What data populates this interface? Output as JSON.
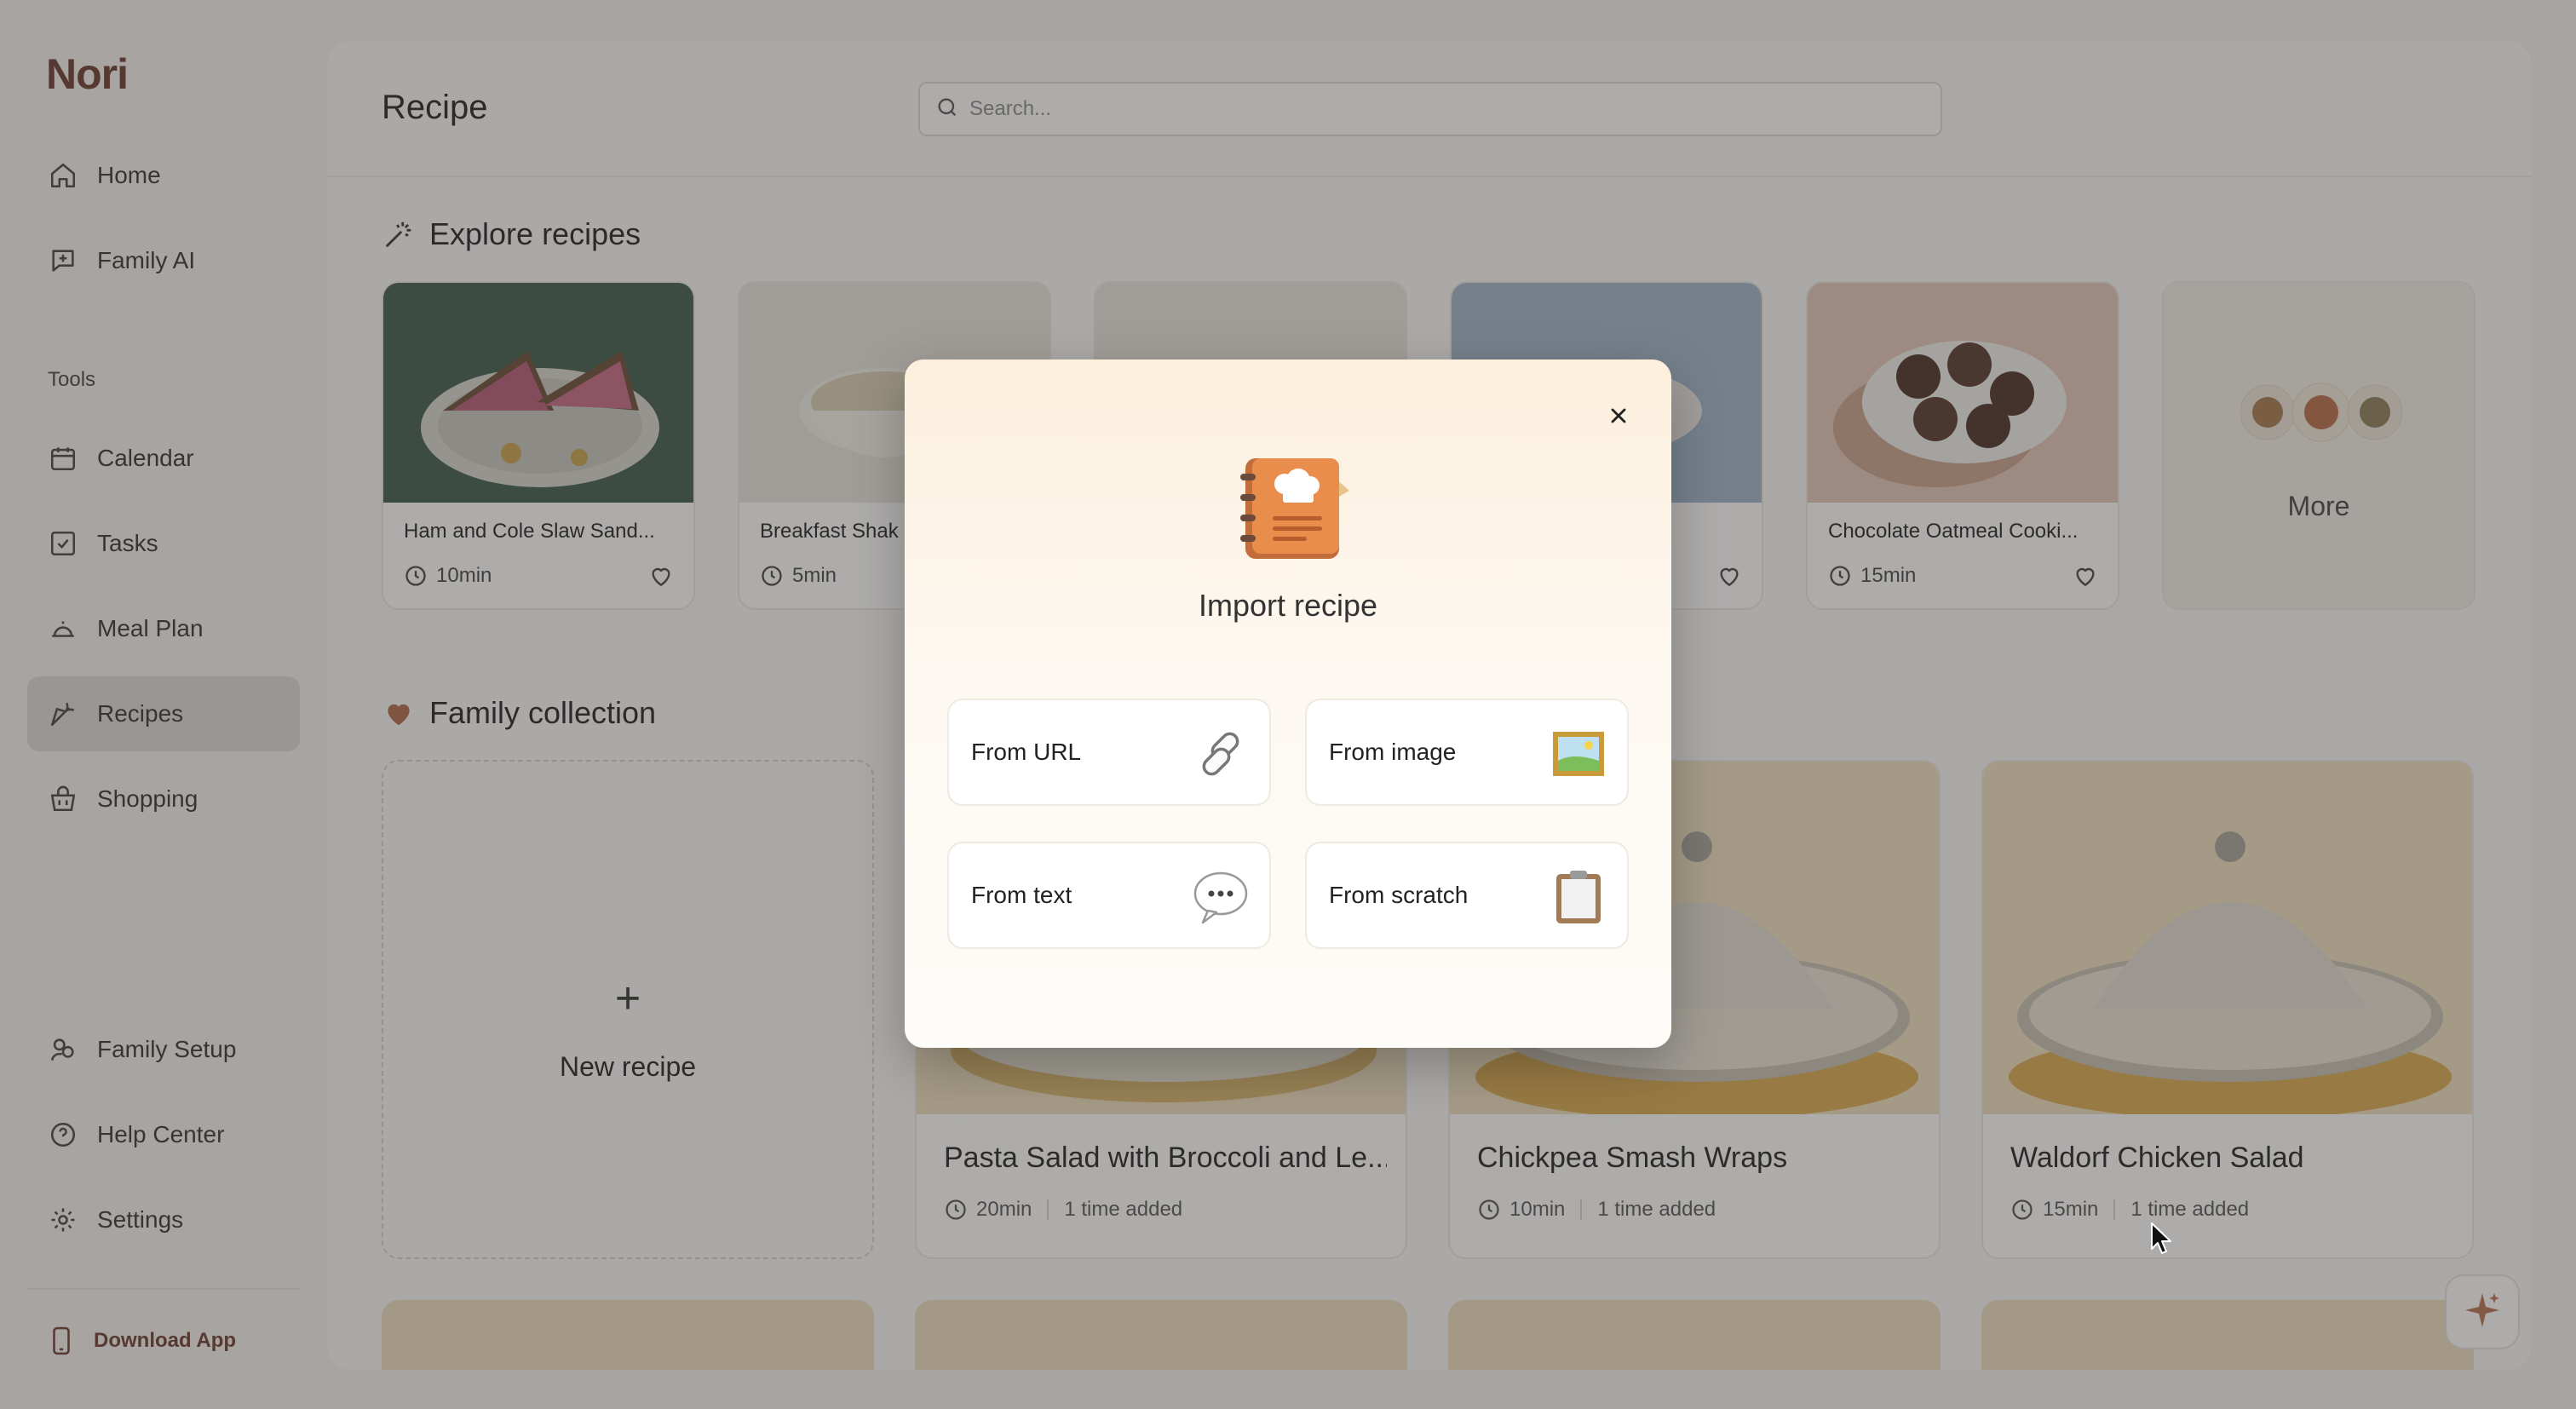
{
  "app": {
    "name": "Nori"
  },
  "sidebar": {
    "items": [
      {
        "label": "Home",
        "icon": "home-icon"
      },
      {
        "label": "Family AI",
        "icon": "chat-plus-icon"
      }
    ],
    "tools_heading": "Tools",
    "tools": [
      {
        "label": "Calendar",
        "icon": "calendar-icon"
      },
      {
        "label": "Tasks",
        "icon": "checkbox-icon"
      },
      {
        "label": "Meal Plan",
        "icon": "cloche-icon"
      },
      {
        "label": "Recipes",
        "icon": "carrot-icon",
        "active": true
      },
      {
        "label": "Shopping",
        "icon": "basket-icon"
      }
    ],
    "bottom": [
      {
        "label": "Family Setup",
        "icon": "family-icon"
      },
      {
        "label": "Help Center",
        "icon": "help-icon"
      },
      {
        "label": "Settings",
        "icon": "gear-icon"
      }
    ],
    "download_label": "Download App"
  },
  "header": {
    "title": "Recipe",
    "search_placeholder": "Search..."
  },
  "explore": {
    "title": "Explore recipes",
    "cards": [
      {
        "name": "Ham and Cole Slaw Sand...",
        "time": "10min"
      },
      {
        "name": "Breakfast Shak",
        "time": "5min"
      },
      {
        "name": "",
        "time": ""
      },
      {
        "name": "",
        "time": ""
      },
      {
        "name": "Chocolate Oatmeal Cooki...",
        "time": "15min"
      }
    ],
    "more_label": "More"
  },
  "family": {
    "title": "Family collection",
    "new_recipe_label": "New recipe",
    "new_recipe_plus": "+",
    "cards": [
      {
        "name": "Pasta Salad with Broccoli and Le...",
        "time": "20min",
        "added": "1 time added"
      },
      {
        "name": "Chickpea Smash Wraps",
        "time": "10min",
        "added": "1 time added"
      },
      {
        "name": "Waldorf Chicken Salad",
        "time": "15min",
        "added": "1 time added"
      }
    ]
  },
  "modal": {
    "title": "Import recipe",
    "options": [
      {
        "label": "From URL",
        "icon": "link-icon"
      },
      {
        "label": "From image",
        "icon": "picture-icon"
      },
      {
        "label": "From text",
        "icon": "speech-bubble-icon"
      },
      {
        "label": "From scratch",
        "icon": "clipboard-icon"
      }
    ]
  },
  "colors": {
    "brand": "#6a3b2f",
    "active_nav": "#dddbd8",
    "overlay": "rgba(60,58,55,0.42)",
    "modal_top": "#fcefdc",
    "modal_bottom": "#fefcf9"
  }
}
